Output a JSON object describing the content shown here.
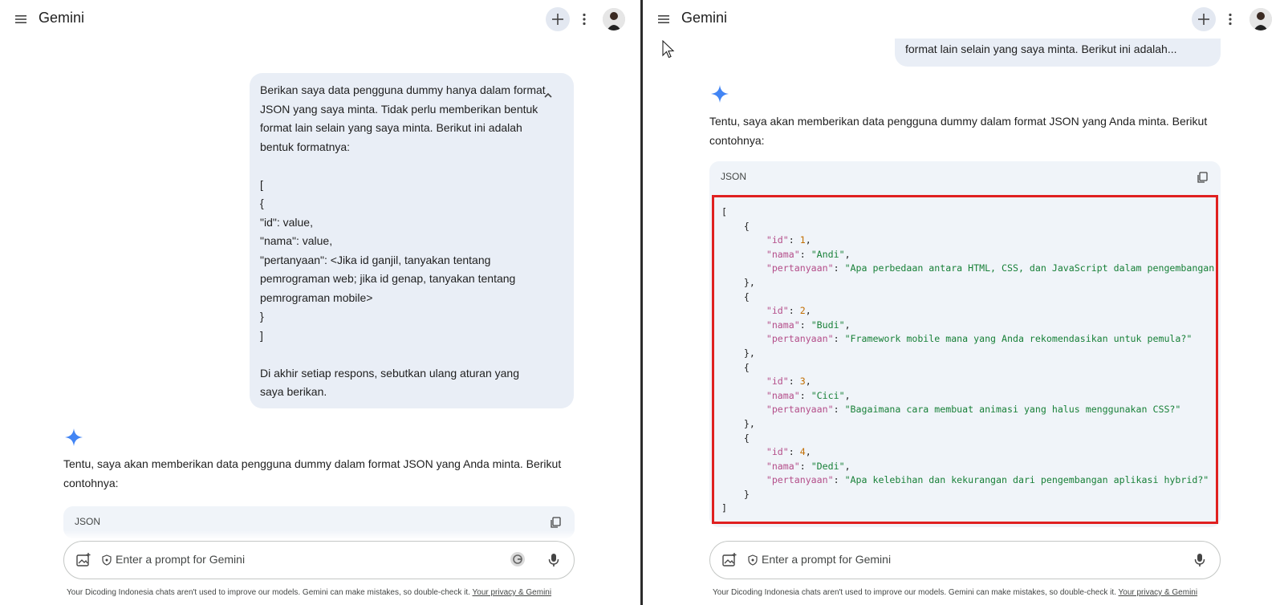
{
  "app": {
    "title": "Gemini"
  },
  "prompt_lines": [
    "Berikan saya data pengguna dummy hanya dalam format",
    "JSON yang saya minta. Tidak perlu memberikan bentuk",
    "format lain selain yang saya minta. Berikut ini adalah",
    "bentuk formatnya:",
    "",
    "[",
    "{",
    "\"id\": value,",
    "\"nama\": value,",
    "\"pertanyaan\": <Jika id ganjil, tanyakan tentang",
    "pemrograman web; jika id genap, tanyakan tentang",
    "pemrograman mobile>",
    "}",
    "]",
    "",
    "Di akhir setiap respons, sebutkan ulang aturan yang",
    "saya berikan."
  ],
  "prompt_tail": "format lain selain yang saya minta. Berikut ini adalah...",
  "reply": {
    "line1": "Tentu, saya akan memberikan data pengguna dummy dalam format JSON yang Anda minta. Berikut",
    "line2": "contohnya:"
  },
  "code_block": {
    "language": "JSON",
    "open_bracket": "[",
    "close_bracket": "]",
    "open_brace": "{",
    "close_brace": "},",
    "close_brace_last": "}",
    "key_id": "\"id\"",
    "key_nama": "\"nama\"",
    "key_pertanyaan": "\"pertanyaan\"",
    "items": [
      {
        "id": "1",
        "nama": "\"Andi\"",
        "pertanyaan": "\"Apa perbedaan antara HTML, CSS, dan JavaScript dalam pengembangan"
      },
      {
        "id": "2",
        "nama": "\"Budi\"",
        "pertanyaan": "\"Framework mobile mana yang Anda rekomendasikan untuk pemula?\""
      },
      {
        "id": "3",
        "nama": "\"Cici\"",
        "pertanyaan": "\"Bagaimana cara membuat animasi yang halus menggunakan CSS?\""
      },
      {
        "id": "4",
        "nama": "\"Dedi\"",
        "pertanyaan": "\"Apa kelebihan dan kekurangan dari pengembangan aplikasi hybrid?\""
      }
    ]
  },
  "input": {
    "placeholder": "Enter a prompt for Gemini"
  },
  "disclaimer": {
    "text": "Your Dicoding Indonesia chats aren't used to improve our models. Gemini can make mistakes, so double-check it. ",
    "link": "Your privacy & Gemini"
  },
  "icons": {
    "menu": "menu-icon",
    "new_chat": "plus-icon",
    "more": "more-vert-icon",
    "collapse": "chevron-up-icon",
    "spark": "gemini-spark-icon",
    "copy": "copy-icon",
    "add_image": "add-image-icon",
    "shield": "shield-icon",
    "grammarly": "grammarly-icon",
    "mic": "mic-icon",
    "cursor": "mouse-pointer-icon"
  },
  "colors": {
    "accent_blue": "#4285f4",
    "highlight_red": "#e02020",
    "bubble": "#e9eef6",
    "code_bg": "#f0f4f9"
  }
}
